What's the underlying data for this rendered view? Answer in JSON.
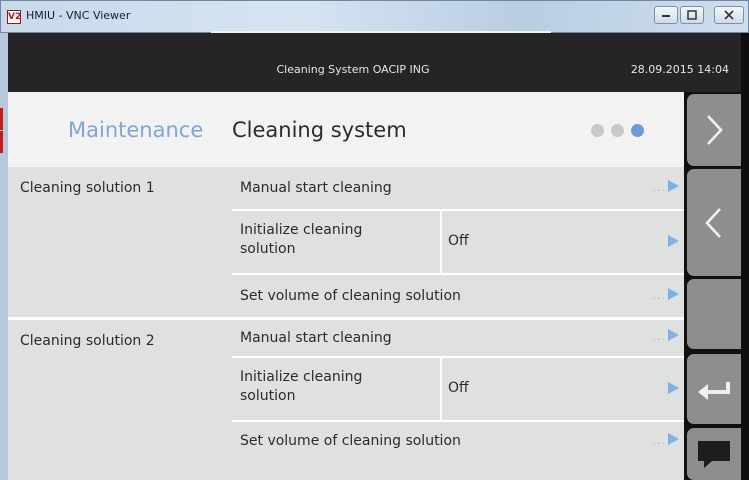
{
  "window": {
    "title": "HMIU - VNC Viewer",
    "icon_text": "V2",
    "controls": [
      "minimize-icon",
      "maximize-icon",
      "close-icon"
    ]
  },
  "topbar": {
    "center_text": "Cleaning System  OACIP ING",
    "datetime": "28.09.2015  14:04"
  },
  "header": {
    "prefix": "Maintenance",
    "title": "Cleaning system",
    "pages": [
      false,
      false,
      true
    ]
  },
  "groups": [
    {
      "label": "Cleaning solution 1",
      "rows": [
        {
          "label": "Manual start cleaning",
          "value": "",
          "more": "..."
        },
        {
          "label": "Initialize cleaning solution",
          "value": "Off",
          "more": ""
        },
        {
          "label": "Set volume of cleaning solution",
          "value": "",
          "more": "..."
        }
      ]
    },
    {
      "label": "Cleaning solution 2",
      "rows": [
        {
          "label": "Manual start cleaning",
          "value": "",
          "more": "..."
        },
        {
          "label": "Initialize cleaning solution",
          "value": "Off",
          "more": ""
        },
        {
          "label": "Set volume of cleaning solution",
          "value": "",
          "more": "..."
        }
      ]
    }
  ],
  "sidebar": {
    "buttons": [
      "chevron-right-icon",
      "chevron-left-icon",
      "blank",
      "back-arrow-icon",
      "message-icon"
    ]
  },
  "colors": {
    "accent_blue": "#7fa6d8",
    "row_bg": "#dfe1e0",
    "topbar_bg": "#252525",
    "sidebar_button": "#8e8e8e"
  }
}
